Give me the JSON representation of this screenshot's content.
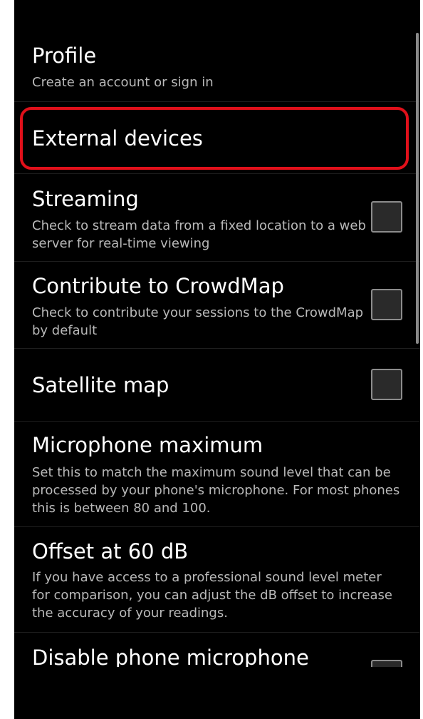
{
  "settings": {
    "profile": {
      "title": "Profile",
      "summary": "Create an account or sign in"
    },
    "external_devices": {
      "title": "External devices"
    },
    "streaming": {
      "title": "Streaming",
      "summary": "Check to stream data from a fixed location to a web server for real-time viewing",
      "checked": false
    },
    "crowdmap": {
      "title": "Contribute to CrowdMap",
      "summary": "Check to contribute your sessions to the CrowdMap by default",
      "checked": false
    },
    "satellite_map": {
      "title": "Satellite map",
      "checked": false
    },
    "microphone_maximum": {
      "title": "Microphone maximum",
      "summary": "Set this to match the maximum sound level that can be processed by your phone's microphone. For most phones this is between 80 and 100."
    },
    "offset": {
      "title": "Offset at 60 dB",
      "summary": "If you have access to a professional sound level meter for comparison, you can adjust the dB offset to increase the accuracy of your readings."
    },
    "disable_microphone": {
      "title": "Disable phone microphone",
      "checked": false
    }
  },
  "colors": {
    "background": "#000000",
    "highlight": "#e0101a",
    "title_text": "#ffffff",
    "summary_text": "#b9b9b9"
  }
}
